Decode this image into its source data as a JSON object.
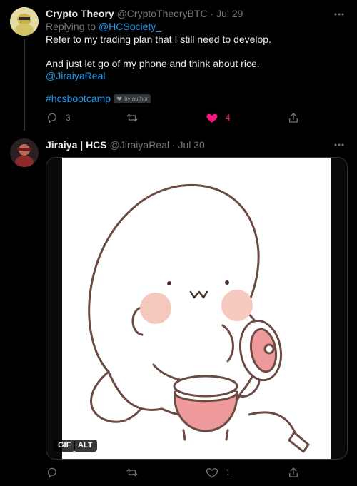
{
  "tweets": [
    {
      "name": "Crypto Theory",
      "handle": "@CryptoTheoryBTC",
      "sep": "·",
      "date": "Jul 29",
      "replying_prefix": "Replying to",
      "replying_handle": "@HCSociety_",
      "line1": "Refer to my trading plan that I still need to develop.",
      "line2": "And just let go of my phone and think about rice.",
      "mention": "@JiraiyaReal",
      "hashtag": "#hcsbootcamp",
      "badge": "by author",
      "reply_count": "3",
      "retweet_count": "",
      "like_count": "4",
      "like_color": "#f91880"
    },
    {
      "name": "Jiraiya | HCS",
      "handle": "@JiraiyaReal",
      "sep": "·",
      "date": "Jul 30",
      "media_badges": [
        "GIF",
        "ALT"
      ],
      "reply_count": "",
      "retweet_count": "",
      "like_count": "1"
    }
  ],
  "icons": [
    "more-icon",
    "reply-icon",
    "retweet-icon",
    "like-icon",
    "share-icon",
    "heart-small-icon"
  ],
  "colors": {
    "background": "#000000",
    "link": "#1d9bf0",
    "muted": "#6e767d"
  }
}
